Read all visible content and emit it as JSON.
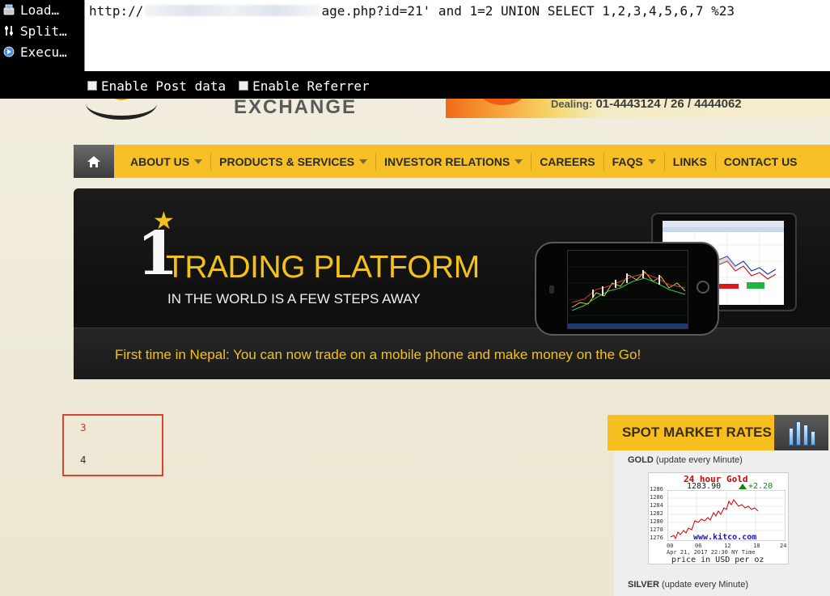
{
  "toolbar": {
    "load_label": "Load",
    "split_label": "Split",
    "execute_label": "Execu",
    "url_prefix": "http://",
    "url_suffix": "age.php?id=21' and 1=2 UNION SELECT 1,2,3,4,5,6,7 %23",
    "enable_post_label": "Enable Post data",
    "enable_referrer_label": "Enable Referrer"
  },
  "header": {
    "logo_text": "EXCHANGE",
    "dealing_label": "Dealing:",
    "dealing_numbers": "01-4443124 / 26 / 4444062"
  },
  "nav": {
    "items": [
      {
        "label": "ABOUT US",
        "has_dropdown": true
      },
      {
        "label": "PRODUCTS & SERVICES",
        "has_dropdown": true
      },
      {
        "label": "INVESTOR RELATIONS",
        "has_dropdown": true
      },
      {
        "label": "CAREERS",
        "has_dropdown": false
      },
      {
        "label": "FAQS",
        "has_dropdown": true
      },
      {
        "label": "LINKS",
        "has_dropdown": false
      },
      {
        "label": "CONTACT US",
        "has_dropdown": false
      }
    ]
  },
  "hero": {
    "number": "1",
    "headline": "TRADING PLATFORM",
    "subheadline": "IN THE WORLD IS A FEW STEPS AWAY",
    "tagline": "First time in Nepal: You can now trade on a mobile phone and make money on the Go!"
  },
  "results": {
    "values": [
      "3",
      "4"
    ]
  },
  "spot_market": {
    "title": "SPOT MARKET RATES",
    "gold_label": "GOLD",
    "gold_note": "(update every Minute)",
    "silver_label": "SILVER",
    "silver_note": "(update every Minute)",
    "chart": {
      "title": "24 hour Gold",
      "price": "1283.90",
      "change": "+2.20",
      "source": "www.kitco.com",
      "date": "Apr 21, 2017 22:30 NY Time",
      "unit": "price in USD per oz",
      "y_ticks": [
        "1286",
        "1286",
        "1284",
        "1282",
        "1280",
        "1278",
        "1276"
      ],
      "x_ticks": [
        "00",
        "06",
        "12",
        "18",
        "24"
      ]
    }
  },
  "colors": {
    "nav_bg": "#f6c026",
    "hero_accent": "#f2c21b",
    "result_border": "#e2402e",
    "toolbar_bg": "#000000",
    "kitco_line": "#d40000"
  }
}
